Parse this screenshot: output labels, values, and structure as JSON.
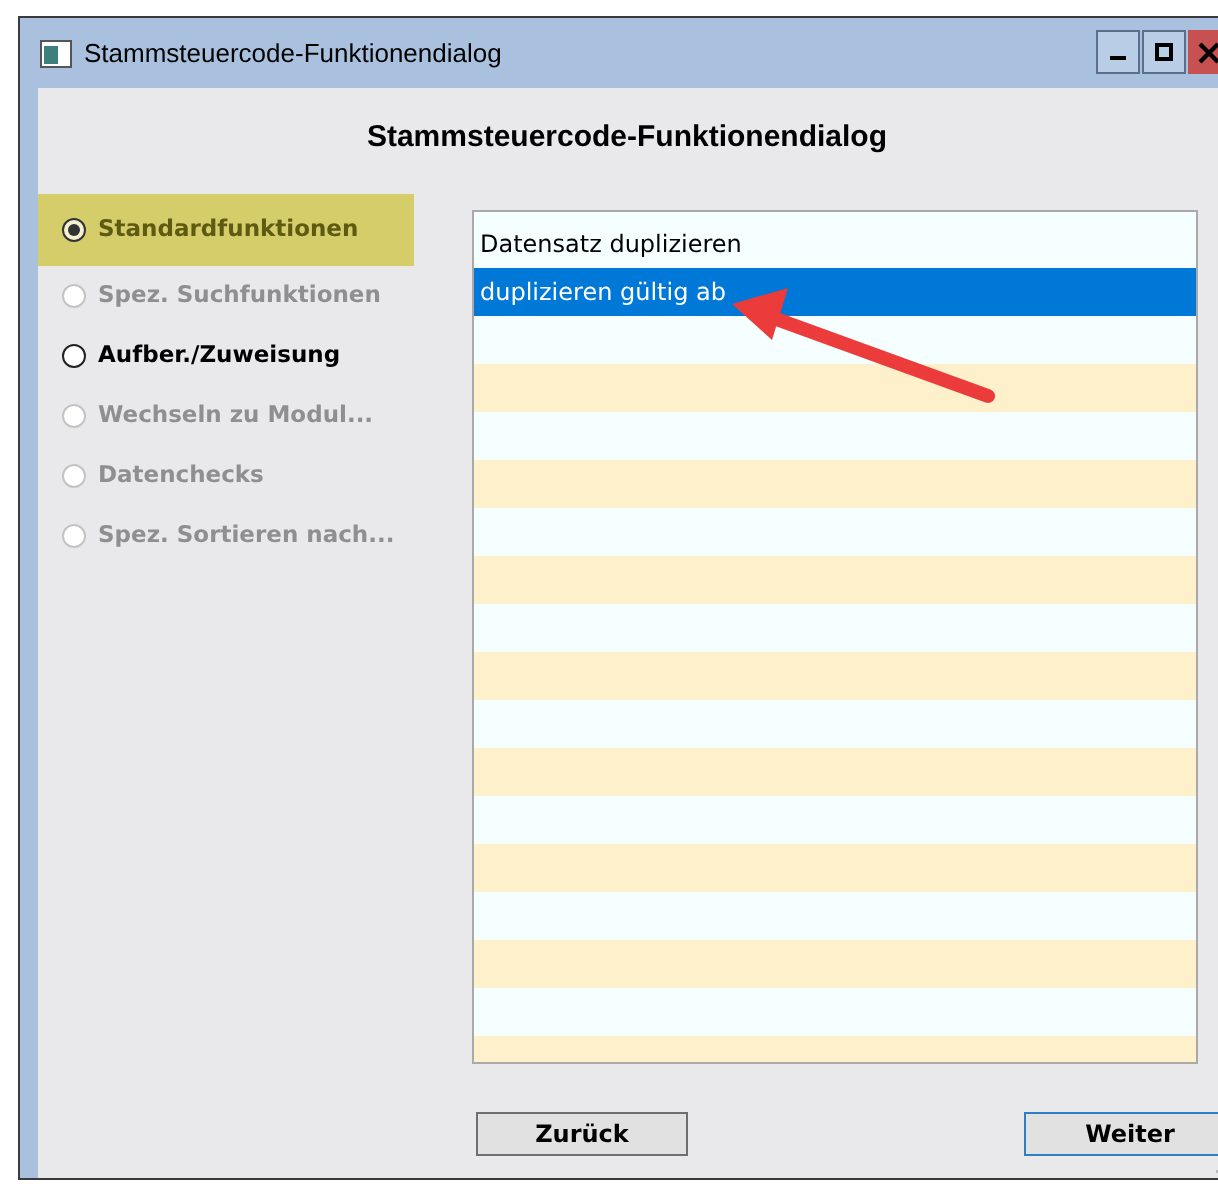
{
  "window": {
    "title": "Stammsteuercode-Funktionendialog"
  },
  "heading": "Stammsteuercode-Funktionendialog",
  "functions": [
    {
      "label": "Standardfunktionen",
      "selected": true,
      "disabled": false
    },
    {
      "label": "Spez. Suchfunktionen",
      "selected": false,
      "disabled": true
    },
    {
      "label": "Aufber./Zuweisung",
      "selected": false,
      "disabled": false
    },
    {
      "label": "Wechseln zu Modul...",
      "selected": false,
      "disabled": true
    },
    {
      "label": "Datenchecks",
      "selected": false,
      "disabled": true
    },
    {
      "label": "Spez. Sortieren nach...",
      "selected": false,
      "disabled": true
    }
  ],
  "list": {
    "items": [
      {
        "label": "Datensatz duplizieren",
        "selected": false
      },
      {
        "label": "duplizieren gültig ab",
        "selected": true
      }
    ]
  },
  "buttons": [
    {
      "label": "Zurück",
      "default": false
    },
    {
      "label": "Weiter",
      "default": true
    }
  ]
}
